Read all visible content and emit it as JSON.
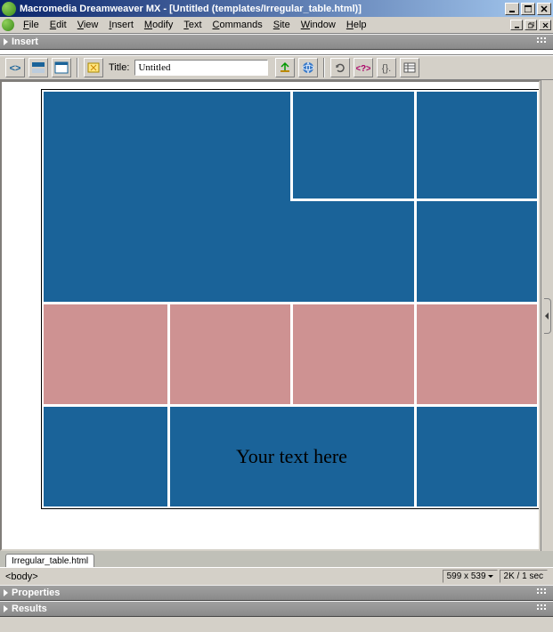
{
  "titlebar": {
    "text": "Macromedia Dreamweaver MX - [Untitled (templates/Irregular_table.html)]"
  },
  "menubar": {
    "file": "File",
    "edit": "Edit",
    "view": "View",
    "insert": "Insert",
    "modify": "Modify",
    "text": "Text",
    "commands": "Commands",
    "site": "Site",
    "window": "Window",
    "help": "Help"
  },
  "panels": {
    "insert": "Insert",
    "properties": "Properties",
    "results": "Results"
  },
  "toolbar": {
    "title_label": "Title:",
    "title_value": "Untitled"
  },
  "canvas": {
    "placeholder": "Your text here"
  },
  "filetab": {
    "name": "Irregular_table.html"
  },
  "status": {
    "tag": "<body>",
    "dimensions": "599 x 539",
    "stats": "2K / 1 sec"
  }
}
